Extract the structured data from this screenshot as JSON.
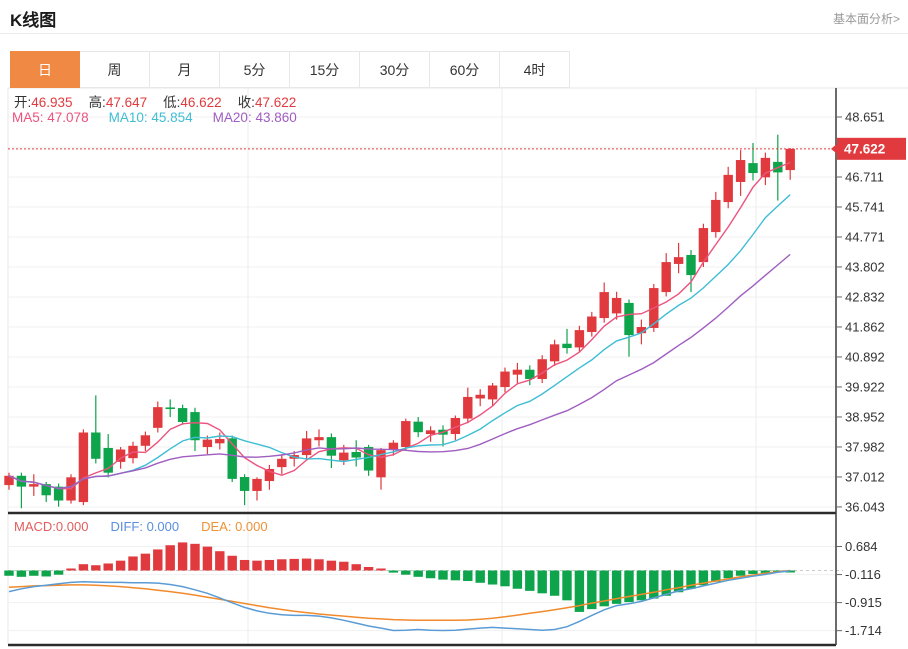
{
  "header": {
    "title": "K线图",
    "link": "基本面分析>"
  },
  "tabs": [
    {
      "label": "日",
      "active": true
    },
    {
      "label": "周",
      "active": false
    },
    {
      "label": "月",
      "active": false
    },
    {
      "label": "5分",
      "active": false
    },
    {
      "label": "15分",
      "active": false
    },
    {
      "label": "30分",
      "active": false
    },
    {
      "label": "60分",
      "active": false
    },
    {
      "label": "4时",
      "active": false
    }
  ],
  "ohlc": {
    "open_label": "开:",
    "open": "46.935",
    "high_label": "高:",
    "high": "47.647",
    "low_label": "低:",
    "low": "46.622",
    "close_label": "收:",
    "close": "47.622"
  },
  "ma": {
    "ma5_label": "MA5:",
    "ma5": "47.078",
    "ma10_label": "MA10:",
    "ma10": "45.854",
    "ma20_label": "MA20:",
    "ma20": "43.860"
  },
  "macd_header": {
    "macd_label": "MACD:",
    "macd": "0.000",
    "diff_label": "DIFF:",
    "diff": "0.000",
    "dea_label": "DEA:",
    "dea": "0.000"
  },
  "colors": {
    "up": "#e03a3e",
    "down": "#0ea44c",
    "ma5": "#ec537e",
    "ma10": "#3fbdd4",
    "ma20": "#a05ec0",
    "diff_line": "#5b9bd5",
    "dea_line": "#f08a2c",
    "tab_active": "#f08943",
    "price_tag": "#e03a3e",
    "grid": "#f1f1f1",
    "vgrid": "#ececec",
    "axis": "#3a3a3a"
  },
  "chart_data": {
    "type": "candlestick",
    "title": "K线图 (日)",
    "price_axis": {
      "step": 0.97,
      "ticks": [
        {
          "label": "48.651",
          "v": 48.651
        },
        {
          "label": "47.681",
          "v": 47.681,
          "hidden": true
        },
        {
          "label": "46.711",
          "v": 46.711
        },
        {
          "label": "45.741",
          "v": 45.741
        },
        {
          "label": "44.771",
          "v": 44.771
        },
        {
          "label": "43.802",
          "v": 43.802
        },
        {
          "label": "42.832",
          "v": 42.832
        },
        {
          "label": "41.862",
          "v": 41.862
        },
        {
          "label": "40.892",
          "v": 40.892
        },
        {
          "label": "39.922",
          "v": 39.922
        },
        {
          "label": "38.952",
          "v": 38.952
        },
        {
          "label": "37.982",
          "v": 37.982
        },
        {
          "label": "37.012",
          "v": 37.012
        },
        {
          "label": "36.043",
          "v": 36.043
        }
      ],
      "last_price": {
        "label": "47.622",
        "v": 47.622
      }
    },
    "candles_format": [
      "open",
      "high",
      "low",
      "close"
    ],
    "candles": [
      [
        36.75,
        37.15,
        36.6,
        37.05
      ],
      [
        37.05,
        37.15,
        36.0,
        36.7
      ],
      [
        36.7,
        37.1,
        36.4,
        36.78
      ],
      [
        36.78,
        36.85,
        36.2,
        36.42
      ],
      [
        36.7,
        36.8,
        36.05,
        36.25
      ],
      [
        36.25,
        37.1,
        36.15,
        37.0
      ],
      [
        36.2,
        38.55,
        36.1,
        38.45
      ],
      [
        38.45,
        39.65,
        37.45,
        37.6
      ],
      [
        37.95,
        38.4,
        37.0,
        37.15
      ],
      [
        37.5,
        37.98,
        37.28,
        37.9
      ],
      [
        37.62,
        38.15,
        37.45,
        38.02
      ],
      [
        38.02,
        38.48,
        37.85,
        38.36
      ],
      [
        38.6,
        39.45,
        38.45,
        39.27
      ],
      [
        39.26,
        39.52,
        38.95,
        39.22
      ],
      [
        39.24,
        39.35,
        38.7,
        38.79
      ],
      [
        39.11,
        39.25,
        37.85,
        38.2
      ],
      [
        37.98,
        38.35,
        37.75,
        38.22
      ],
      [
        38.1,
        38.45,
        37.9,
        38.24
      ],
      [
        38.26,
        38.35,
        36.85,
        36.95
      ],
      [
        37.01,
        37.1,
        36.1,
        36.56
      ],
      [
        36.56,
        37.0,
        36.25,
        36.95
      ],
      [
        36.88,
        37.4,
        36.6,
        37.27
      ],
      [
        37.33,
        37.75,
        37.1,
        37.6
      ],
      [
        37.6,
        37.85,
        37.35,
        37.72
      ],
      [
        37.72,
        38.5,
        37.55,
        38.26
      ],
      [
        38.2,
        38.55,
        38.0,
        38.3
      ],
      [
        38.3,
        38.42,
        37.3,
        37.7
      ],
      [
        37.55,
        38.05,
        37.4,
        37.8
      ],
      [
        37.82,
        38.2,
        37.35,
        37.64
      ],
      [
        37.98,
        38.05,
        37.05,
        37.22
      ],
      [
        37.0,
        37.95,
        36.6,
        37.88
      ],
      [
        37.9,
        38.2,
        37.7,
        38.12
      ],
      [
        37.98,
        38.9,
        37.85,
        38.82
      ],
      [
        38.8,
        38.95,
        38.3,
        38.46
      ],
      [
        38.4,
        38.65,
        38.15,
        38.52
      ],
      [
        38.54,
        38.68,
        38.0,
        38.38
      ],
      [
        38.4,
        39.0,
        38.2,
        38.92
      ],
      [
        38.9,
        39.9,
        38.75,
        39.6
      ],
      [
        39.55,
        39.85,
        39.3,
        39.67
      ],
      [
        39.52,
        40.05,
        39.3,
        39.97
      ],
      [
        39.92,
        40.55,
        39.75,
        40.42
      ],
      [
        40.32,
        40.7,
        40.0,
        40.48
      ],
      [
        40.48,
        40.62,
        39.98,
        40.18
      ],
      [
        40.18,
        40.95,
        40.05,
        40.82
      ],
      [
        40.75,
        41.45,
        40.6,
        41.3
      ],
      [
        41.32,
        41.8,
        41.0,
        41.18
      ],
      [
        41.2,
        41.9,
        41.05,
        41.76
      ],
      [
        41.7,
        42.35,
        41.55,
        42.2
      ],
      [
        42.15,
        43.3,
        42.0,
        42.99
      ],
      [
        42.3,
        43.0,
        42.1,
        42.8
      ],
      [
        42.64,
        42.75,
        40.9,
        41.6
      ],
      [
        41.66,
        42.1,
        41.3,
        41.86
      ],
      [
        41.83,
        43.25,
        41.7,
        43.12
      ],
      [
        42.99,
        44.25,
        42.85,
        43.96
      ],
      [
        43.9,
        44.58,
        43.6,
        44.12
      ],
      [
        44.19,
        44.35,
        42.99,
        43.54
      ],
      [
        43.96,
        45.2,
        43.8,
        45.06
      ],
      [
        44.93,
        46.23,
        44.75,
        45.97
      ],
      [
        45.9,
        47.04,
        45.7,
        46.78
      ],
      [
        46.55,
        47.58,
        46.1,
        47.26
      ],
      [
        47.16,
        47.81,
        46.6,
        46.84
      ],
      [
        46.7,
        47.5,
        46.45,
        47.33
      ],
      [
        47.2,
        48.08,
        45.95,
        46.86
      ],
      [
        46.935,
        47.647,
        46.622,
        47.622
      ]
    ],
    "ma_periods": {
      "ma5": 5,
      "ma10": 10,
      "ma20": 20
    },
    "vgrid_xs": [
      248,
      502,
      756
    ],
    "macd": {
      "ticks": [
        {
          "label": "0.684",
          "v": 0.684
        },
        {
          "label": "-0.116",
          "v": -0.116
        },
        {
          "label": "-0.915",
          "v": -0.915
        },
        {
          "label": "-1.714",
          "v": -1.714
        }
      ],
      "hist": [
        -0.15,
        -0.18,
        -0.15,
        -0.17,
        -0.12,
        0.03,
        0.18,
        0.15,
        0.2,
        0.28,
        0.4,
        0.48,
        0.6,
        0.72,
        0.8,
        0.76,
        0.68,
        0.55,
        0.42,
        0.3,
        0.28,
        0.3,
        0.32,
        0.33,
        0.34,
        0.32,
        0.28,
        0.25,
        0.18,
        0.1,
        0.05,
        -0.06,
        -0.12,
        -0.18,
        -0.22,
        -0.26,
        -0.28,
        -0.3,
        -0.35,
        -0.4,
        -0.45,
        -0.52,
        -0.58,
        -0.65,
        -0.72,
        -0.85,
        -1.18,
        -1.1,
        -1.02,
        -0.95,
        -0.9,
        -0.85,
        -0.8,
        -0.72,
        -0.62,
        -0.52,
        -0.42,
        -0.32,
        -0.22,
        -0.15,
        -0.1,
        -0.07,
        -0.04,
        -0.005
      ],
      "diff": [
        -0.6,
        -0.52,
        -0.46,
        -0.42,
        -0.38,
        -0.34,
        -0.32,
        -0.33,
        -0.34,
        -0.34,
        -0.35,
        -0.35,
        -0.36,
        -0.4,
        -0.46,
        -0.55,
        -0.65,
        -0.78,
        -0.92,
        -1.05,
        -1.15,
        -1.22,
        -1.26,
        -1.28,
        -1.28,
        -1.3,
        -1.35,
        -1.42,
        -1.5,
        -1.58,
        -1.64,
        -1.71,
        -1.7,
        -1.68,
        -1.7,
        -1.71,
        -1.7,
        -1.67,
        -1.64,
        -1.62,
        -1.64,
        -1.66,
        -1.68,
        -1.7,
        -1.68,
        -1.6,
        -1.45,
        -1.28,
        -1.12,
        -1.0,
        -0.95,
        -0.88,
        -0.78,
        -0.68,
        -0.58,
        -0.52,
        -0.44,
        -0.36,
        -0.28,
        -0.22,
        -0.16,
        -0.11,
        -0.05,
        -0.01
      ],
      "dea": [
        -0.48,
        -0.46,
        -0.44,
        -0.43,
        -0.42,
        -0.41,
        -0.41,
        -0.42,
        -0.44,
        -0.46,
        -0.49,
        -0.52,
        -0.56,
        -0.6,
        -0.65,
        -0.7,
        -0.76,
        -0.82,
        -0.88,
        -0.94,
        -1.0,
        -1.06,
        -1.11,
        -1.16,
        -1.2,
        -1.24,
        -1.27,
        -1.3,
        -1.33,
        -1.36,
        -1.38,
        -1.4,
        -1.41,
        -1.42,
        -1.42,
        -1.42,
        -1.42,
        -1.41,
        -1.39,
        -1.36,
        -1.32,
        -1.27,
        -1.22,
        -1.17,
        -1.12,
        -1.06,
        -1.0,
        -0.93,
        -0.87,
        -0.8,
        -0.74,
        -0.68,
        -0.62,
        -0.55,
        -0.49,
        -0.42,
        -0.36,
        -0.3,
        -0.24,
        -0.18,
        -0.13,
        -0.08,
        -0.04,
        0.0
      ]
    }
  }
}
